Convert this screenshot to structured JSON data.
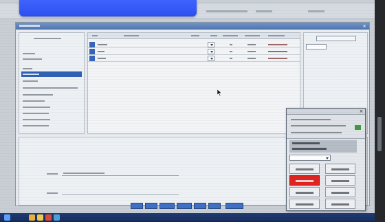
{
  "colors": {
    "banner": "#2b4ef0",
    "selection": "#2d5fb2",
    "primary_red": "#e0221f",
    "status_green": "#3c9a3c",
    "taskbar": "#1f3a73"
  },
  "icons": {
    "cursor": "mouse-pointer-icon",
    "close": "close-icon",
    "dropdown": "chevron-down-icon"
  },
  "taskbar": {
    "apps": [
      {
        "icon": "start-icon",
        "color": "#5aa0ff"
      },
      {
        "icon": "chrome-icon",
        "color": "#e8b23a"
      },
      {
        "icon": "folder-icon",
        "color": "#f2c94c"
      },
      {
        "icon": "app-icon",
        "color": "#d94a3a"
      },
      {
        "icon": "app-icon-2",
        "color": "#4aa0d8"
      }
    ]
  },
  "window": {
    "title": ""
  }
}
